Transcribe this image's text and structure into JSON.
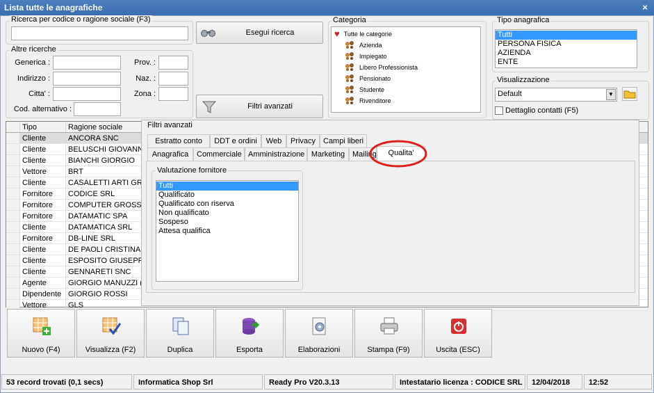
{
  "window": {
    "title": "Lista tutte le anagrafiche",
    "close_label": "×"
  },
  "search": {
    "group_label": "Ricerca per codice o ragione sociale (F3)",
    "value": "",
    "run_label": "Esegui ricerca",
    "filters_label": "Filtri avanzati"
  },
  "other": {
    "group_label": "Altre ricerche",
    "generica": "Generica :",
    "indirizzo": "Indirizzo :",
    "citta": "Citta' :",
    "cod_alt": "Cod. alternativo :",
    "prov": "Prov. :",
    "naz": "Naz. :",
    "zona": "Zona :"
  },
  "categoria": {
    "group_label": "Categoria",
    "root": "Tutte le categorie",
    "items": [
      "Azienda",
      "Impiegato",
      "Libero Professionista",
      "Pensionato",
      "Studente",
      "Rivenditore"
    ]
  },
  "tipo": {
    "group_label": "Tipo anagrafica",
    "items": [
      "Tutti",
      "PERSONA FISICA",
      "AZIENDA",
      "ENTE"
    ],
    "selected": 0
  },
  "visual": {
    "group_label": "Visualizzazione",
    "selected": "Default",
    "detail_label": "Dettaglio contatti (F5)",
    "detail_checked": false
  },
  "grid": {
    "columns": [
      "Tipo",
      "Ragione sociale"
    ],
    "rows": [
      [
        "Cliente",
        "ANCORA SNC"
      ],
      [
        "Cliente",
        "BELUSCHI GIOVANNI"
      ],
      [
        "Cliente",
        "BIANCHI GIORGIO"
      ],
      [
        "Vettore",
        "BRT"
      ],
      [
        "Cliente",
        "CASALETTI ARTI GRA"
      ],
      [
        "Fornitore",
        "CODICE SRL"
      ],
      [
        "Fornitore",
        "COMPUTER GROSS SP"
      ],
      [
        "Fornitore",
        "DATAMATIC SPA"
      ],
      [
        "Cliente",
        "DATAMATICA SRL"
      ],
      [
        "Fornitore",
        "DB-LINE SRL"
      ],
      [
        "Cliente",
        "DE PAOLI CRISTINA"
      ],
      [
        "Cliente",
        "ESPOSITO GIUSEPPE"
      ],
      [
        "Cliente",
        "GENNARETI SNC"
      ],
      [
        "Agente",
        "GIORGIO MANUZZI (C"
      ],
      [
        "Dipendente",
        "GIORGIO ROSSI"
      ],
      [
        "Vettore",
        "GLS"
      ]
    ]
  },
  "advanced": {
    "title": "Filtri avanzati",
    "tabs_row1": [
      "Estratto conto",
      "DDT e ordini",
      "Web",
      "Privacy",
      "Campi liberi"
    ],
    "tabs_row2": [
      "Anagrafica",
      "Commerciale",
      "Amministrazione",
      "Marketing",
      "Mailing",
      "Qualita'"
    ],
    "active_tab": "Qualita'",
    "valutazione": {
      "group_label": "Valutazione fornitore",
      "items": [
        "Tutti",
        "Qualificato",
        "Qualificato con riserva",
        "Non qualificato",
        "Sospeso",
        "Attesa qualifica"
      ],
      "selected": 0
    }
  },
  "toolbar": {
    "buttons": [
      {
        "label": "Nuovo (F4)",
        "icon": "new-record-icon"
      },
      {
        "label": "Visualizza (F2)",
        "icon": "view-record-icon"
      },
      {
        "label": "Duplica",
        "icon": "duplicate-icon"
      },
      {
        "label": "Esporta",
        "icon": "export-database-icon"
      },
      {
        "label": "Elaborazioni",
        "icon": "processing-gear-icon"
      },
      {
        "label": "Stampa (F9)",
        "icon": "printer-icon"
      },
      {
        "label": "Uscita (ESC)",
        "icon": "exit-power-icon"
      }
    ]
  },
  "statusbar": {
    "records": "53 record trovati (0,1 secs)",
    "company": "Informatica Shop Srl",
    "version": "Ready Pro V20.3.13",
    "license": "Intestatario licenza : CODICE SRL",
    "date": "12/04/2018",
    "time": "12:52"
  },
  "colors": {
    "accent": "#3399ff",
    "title_bar": "#3b6eb0",
    "highlight_circle": "#e02020"
  }
}
